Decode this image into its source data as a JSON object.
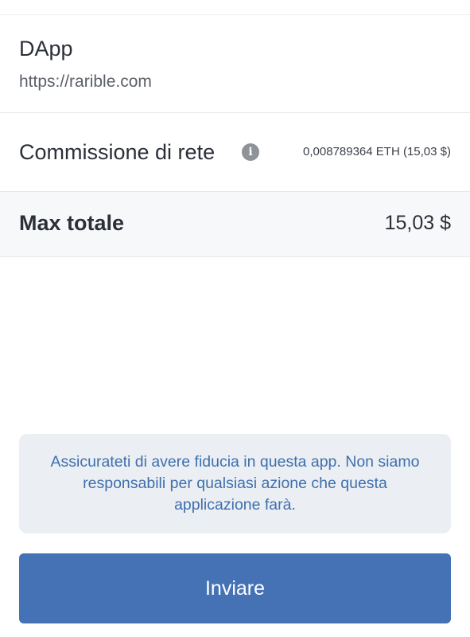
{
  "dapp": {
    "label": "DApp",
    "url": "https://rarible.com"
  },
  "network_fee": {
    "label": "Commissione di rete",
    "info_icon": "i",
    "value": "0,008789364 ETH (15,03 $)"
  },
  "total": {
    "label": "Max totale",
    "value": "15,03 $"
  },
  "warning": {
    "text": "Assicurateti di avere fiducia in questa app. Non siamo responsabili per qualsiasi azione che questa applicazione farà."
  },
  "actions": {
    "send_label": "Inviare"
  },
  "colors": {
    "accent": "#4472b5",
    "warning_bg": "#ebeff4",
    "warning_text": "#3f6fad"
  }
}
